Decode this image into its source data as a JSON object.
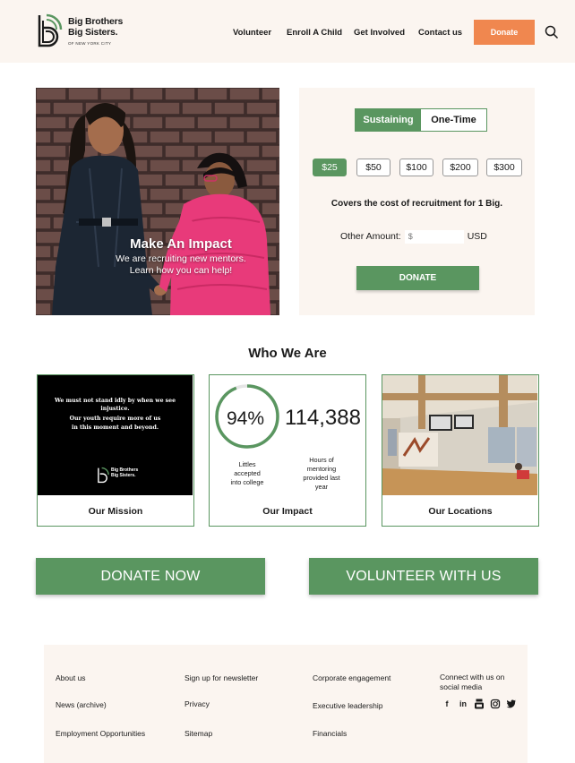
{
  "header": {
    "logo_line1": "Big Brothers",
    "logo_line2": "Big Sisters.",
    "logo_sub": "OF NEW YORK CITY",
    "nav": [
      "Volunteer",
      "Enroll A Child",
      "Get Involved",
      "Contact us"
    ],
    "donate_label": "Donate"
  },
  "hero": {
    "title": "Make An Impact",
    "subtitle_line1": "We are recruiting new mentors.",
    "subtitle_line2": "Learn how you can help!"
  },
  "donation": {
    "tabs": [
      "Sustaining",
      "One-Time"
    ],
    "active_tab": "Sustaining",
    "amounts": [
      "$25",
      "$50",
      "$100",
      "$200",
      "$300"
    ],
    "selected_amount": "$25",
    "covers_text": "Covers the cost of recruitment for 1 Big.",
    "other_label": "Other Amount:",
    "other_placeholder": "$",
    "currency": "USD",
    "donate_button": "DONATE"
  },
  "who_we_are": {
    "title": "Who We Are",
    "mission": {
      "quote1": "We must not stand idly by when we see injustice.",
      "quote2_line1": "Our youth require more of us",
      "quote2_line2": "in this moment and beyond.",
      "mini_logo_line1": "Big Brothers",
      "mini_logo_line2": "Big Sisters.",
      "label": "Our Mission"
    },
    "impact": {
      "percent": "94%",
      "percent_value": 0.94,
      "hours": "114,388",
      "percent_desc_lines": [
        "Littles",
        "accepted",
        "into college"
      ],
      "hours_desc_lines": [
        "Hours of",
        "mentoring",
        "provided last",
        "year"
      ],
      "label": "Our Impact"
    },
    "locations": {
      "label": "Our Locations"
    }
  },
  "cta": {
    "donate_now": "DONATE NOW",
    "volunteer": "VOLUNTEER WITH US"
  },
  "footer": {
    "col1": [
      "About us",
      "News (archive)",
      "Employment Opportunities"
    ],
    "col2": [
      "Sign up for newsletter",
      "Privacy",
      "Sitemap"
    ],
    "col3": [
      "Corporate engagement",
      "Executive leadership",
      "Financials"
    ],
    "social_title_line1": "Connect with us on",
    "social_title_line2": "social media",
    "socials": [
      "facebook-icon",
      "linkedin-icon",
      "youtube-icon",
      "instagram-icon",
      "twitter-icon"
    ]
  },
  "colors": {
    "green": "#5a9660",
    "orange": "#f0874f",
    "cream": "#fbf5f0"
  }
}
